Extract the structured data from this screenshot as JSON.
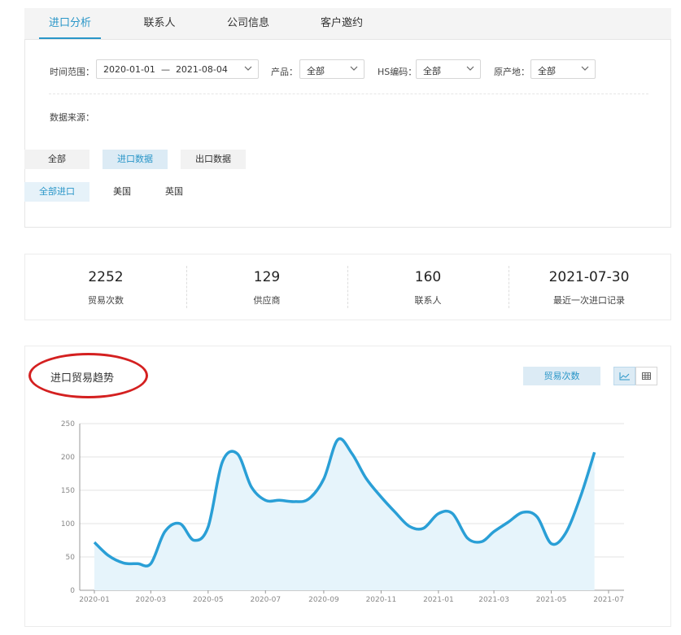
{
  "tabs": [
    {
      "label": "进口分析",
      "active": true
    },
    {
      "label": "联系人",
      "active": false
    },
    {
      "label": "公司信息",
      "active": false
    },
    {
      "label": "客户邀约",
      "active": false
    }
  ],
  "filters": {
    "date_label": "时间范围：",
    "date_start": "2020-01-01",
    "date_sep": "—",
    "date_end": "2021-08-04",
    "product_label": "产品：",
    "product_value": "全部",
    "hs_label": "HS编码：",
    "hs_value": "全部",
    "origin_label": "原产地：",
    "origin_value": "全部",
    "source_label": "数据来源："
  },
  "source_buttons": [
    {
      "label": "全部",
      "active": false
    },
    {
      "label": "进口数据",
      "active": true
    },
    {
      "label": "出口数据",
      "active": false
    }
  ],
  "country_buttons": [
    {
      "label": "全部进口",
      "active": true
    },
    {
      "label": "美国",
      "active": false
    },
    {
      "label": "英国",
      "active": false
    }
  ],
  "stats": [
    {
      "value": "2252",
      "label": "贸易次数"
    },
    {
      "value": "129",
      "label": "供应商"
    },
    {
      "value": "160",
      "label": "联系人"
    },
    {
      "value": "2021-07-30",
      "label": "最近一次进口记录"
    }
  ],
  "chart_panel": {
    "title": "进口贸易趋势",
    "metric_button": "贸易次数",
    "annotation_color": "#d42020"
  },
  "colors": {
    "accent": "#2a96c8",
    "line": "#2a9fd6",
    "area": "#e6f4fb"
  },
  "chart_data": {
    "type": "area",
    "x": [
      "2020-01-01",
      "2020-01-16",
      "2020-02-01",
      "2020-02-16",
      "2020-03-01",
      "2020-03-16",
      "2020-04-01",
      "2020-04-16",
      "2020-05-01",
      "2020-05-16",
      "2020-06-01",
      "2020-06-16",
      "2020-07-01",
      "2020-07-16",
      "2020-08-01",
      "2020-08-16",
      "2020-09-01",
      "2020-09-16",
      "2020-10-01",
      "2020-10-16",
      "2020-11-01",
      "2020-11-16",
      "2020-12-01",
      "2020-12-16",
      "2021-01-01",
      "2021-01-16",
      "2021-02-01",
      "2021-02-16",
      "2021-03-01",
      "2021-03-16",
      "2021-04-01",
      "2021-04-16",
      "2021-05-01",
      "2021-05-16",
      "2021-06-01",
      "2021-06-16",
      "2021-07-01",
      "2021-07-16"
    ],
    "values": [
      72,
      52,
      41,
      40,
      40,
      88,
      100,
      75,
      95,
      192,
      205,
      155,
      135,
      135,
      133,
      137,
      167,
      226,
      205,
      168,
      140,
      117,
      96,
      93,
      115,
      115,
      78,
      73,
      88,
      102,
      117,
      110,
      70,
      85,
      140,
      207
    ],
    "x_ticks": [
      "2020-01",
      "2020-03",
      "2020-05",
      "2020-07",
      "2020-09",
      "2020-11",
      "2021-01",
      "2021-03",
      "2021-05",
      "2021-07"
    ],
    "y_ticks": [
      0,
      50,
      100,
      150,
      200,
      250
    ],
    "ylim": [
      0,
      250
    ],
    "grid": true,
    "series": [
      {
        "name": "贸易次数"
      }
    ]
  }
}
